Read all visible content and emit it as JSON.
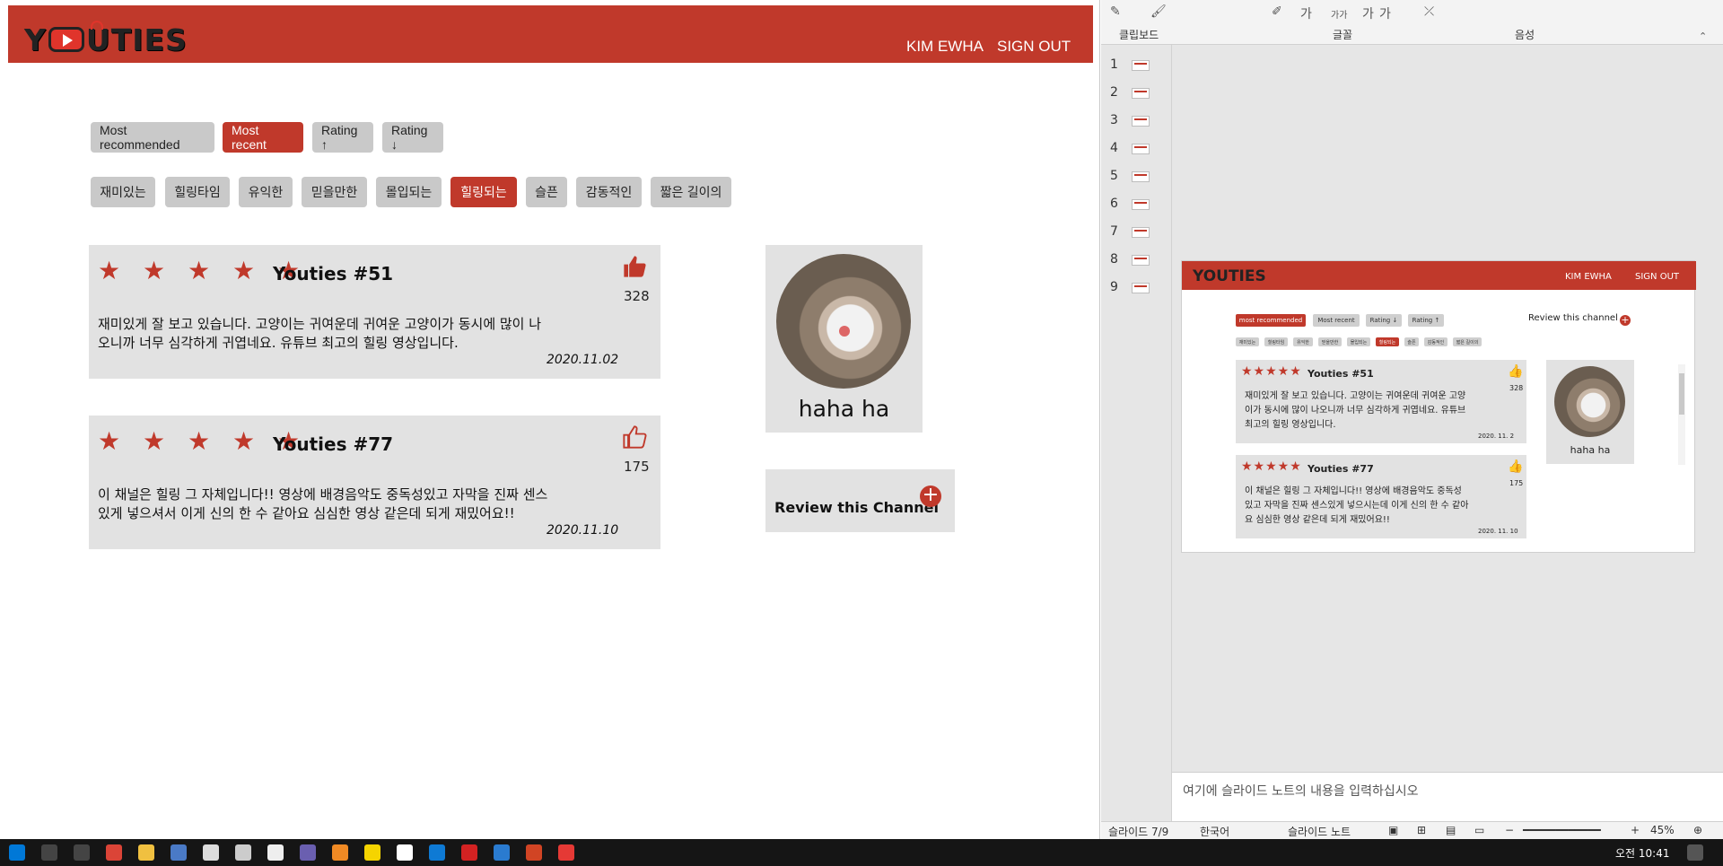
{
  "web": {
    "logo": "YOUTIES",
    "nav": {
      "user": "KIM EWHA",
      "signout": "SIGN OUT"
    },
    "sort_buttons": [
      "Most recommended",
      "Most recent",
      "Rating ↑",
      "Rating ↓"
    ],
    "active_sort": "Most recent",
    "tags": [
      "재미있는",
      "힐링타임",
      "유익한",
      "믿을만한",
      "몰입되는",
      "힐링되는",
      "슬픈",
      "감동적인",
      "짧은 길이의"
    ],
    "active_tag": "힐링되는",
    "reviews": [
      {
        "title": "Youties #51",
        "stars": "★ ★ ★ ★ ★",
        "likes": "328",
        "liked": true,
        "line1": "재미있게 잘 보고 있습니다. 고양이는 귀여운데 귀여운 고양이가 동시에 많이 나",
        "line2": "오니까 너무 심각하게 귀엽네요. 유튜브 최고의 힐링 영상입니다.",
        "date": "2020.11.02"
      },
      {
        "title": "Youties #77",
        "stars": "★ ★ ★ ★ ★",
        "likes": "175",
        "liked": false,
        "line1": "이 채널은 힐링 그 자체입니다!! 영상에 배경음악도 중독성있고 자막을 진짜 센스",
        "line2": "있게 넣으셔서 이게 신의 한 수 같아요 심심한 영상 같은데 되게 재밌어요!!",
        "date": "2020.11.10"
      }
    ],
    "profile_name": "haha ha",
    "review_channel": "Review this Channel"
  },
  "ppt": {
    "ribbon_groups": [
      "클립보드",
      "글꼴",
      "음성"
    ],
    "ribbon_top": [
      "클립보드",
      "쓰기"
    ],
    "slide_numbers": [
      "1",
      "2",
      "3",
      "4",
      "5",
      "6",
      "7",
      "8",
      "9"
    ],
    "slide": {
      "logo": "YOUTIES",
      "user": "KIM EWHA",
      "signout": "SIGN OUT",
      "sort_buttons": [
        "most recommended",
        "Most recent",
        "Rating ↓",
        "Rating ↑"
      ],
      "review_channel": "Review this channel",
      "tags": [
        "재미있는",
        "힐링타임",
        "유익한",
        "믿을만한",
        "몰입되는",
        "힐링되는",
        "슬픈",
        "감동적인",
        "짧은 길이의"
      ],
      "reviews": [
        {
          "title": "Youties #51",
          "likes": "328",
          "lines": [
            "재미있게 잘 보고 있습니다. 고양이는 귀여운데 귀여운 고양",
            "이가 동시에 많이 나오니까 너무 심각하게 귀엽네요. 유튜브",
            "최고의 힐링 영상입니다."
          ],
          "date": "2020. 11. 2"
        },
        {
          "title": "Youties #77",
          "likes": "175",
          "lines": [
            "이 채널은 힐링 그 자체입니다!! 영상에 배경음악도 중독성",
            "있고 자막을 진짜 센스있게 넣으시는데 이게 신의 한 수 같아",
            "요 심심한 영상 같은데 되게 재밌어요!!"
          ],
          "date": "2020. 11. 10"
        }
      ],
      "profile_name": "haha ha"
    },
    "notes": "여기에 슬라이드 노트의 내용을 입력하십시오",
    "status": {
      "slide": "슬라이드 7/9",
      "lang": "한국어",
      "notes_btn": "슬라이드 노트",
      "zoom": "45%"
    }
  },
  "taskbar": {
    "time": "오전 10:41"
  }
}
